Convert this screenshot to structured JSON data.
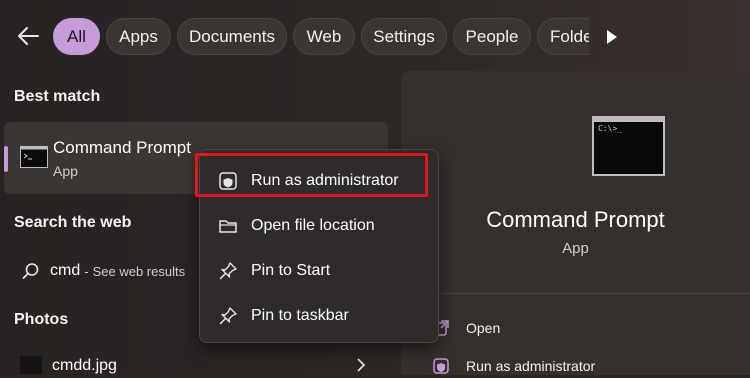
{
  "filters": {
    "back_label": "",
    "chips": [
      "All",
      "Apps",
      "Documents",
      "Web",
      "Settings",
      "People",
      "Folde"
    ],
    "active_index": 0
  },
  "results": {
    "best_match_header": "Best match",
    "best_match": {
      "name": "Command Prompt",
      "type": "App",
      "icon": "terminal-icon"
    },
    "search_web_header": "Search the web",
    "web_item": {
      "query": "cmd",
      "separator": "-",
      "hint": "See web results",
      "icon": "search-icon"
    },
    "photos_header": "Photos",
    "photo_item": {
      "name": "cmdd.jpg",
      "icon": "image-icon"
    }
  },
  "context_menu": {
    "items": [
      {
        "label": "Run as administrator",
        "icon": "shield-icon"
      },
      {
        "label": "Open file location",
        "icon": "folder-icon"
      },
      {
        "label": "Pin to Start",
        "icon": "pin-icon"
      },
      {
        "label": "Pin to taskbar",
        "icon": "pin-icon"
      }
    ],
    "highlight_color": "#e0181c"
  },
  "details": {
    "app_name": "Command Prompt",
    "app_type": "App",
    "terminal_prompt": "C:\\>_",
    "actions": [
      {
        "label": "Open",
        "icon": "open-icon"
      },
      {
        "label": "Run as administrator",
        "icon": "shield-icon"
      }
    ]
  },
  "colors": {
    "accent": "#c79ad9",
    "background": "#2a2624",
    "highlight": "#e0181c"
  }
}
